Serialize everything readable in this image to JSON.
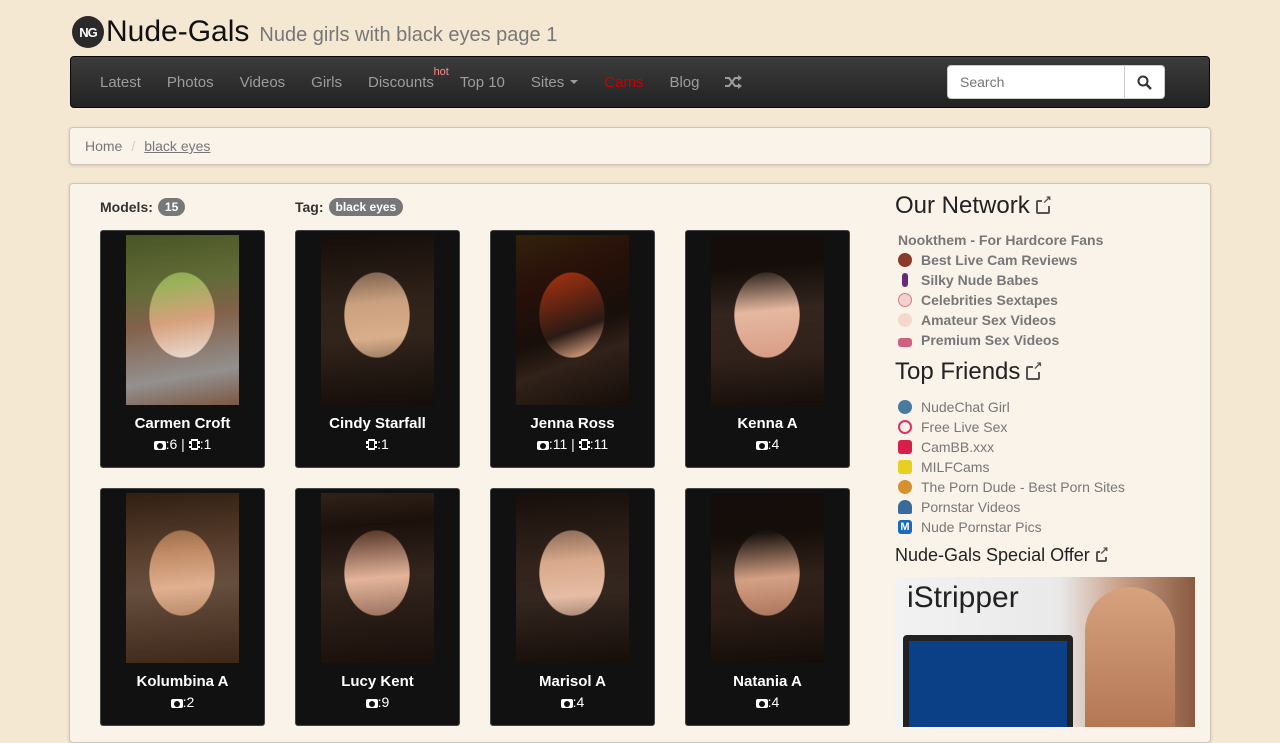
{
  "header": {
    "logo_text": "NG",
    "site_name": "Nude-Gals",
    "tagline": "Nude girls with black eyes page 1"
  },
  "nav": {
    "items": [
      {
        "label": "Latest"
      },
      {
        "label": "Photos"
      },
      {
        "label": "Videos"
      },
      {
        "label": "Girls"
      },
      {
        "label": "Discounts",
        "badge": "hot"
      },
      {
        "label": "Top 10"
      },
      {
        "label": "Sites"
      },
      {
        "label": "Cams"
      },
      {
        "label": "Blog"
      }
    ],
    "search_placeholder": "Search"
  },
  "breadcrumb": {
    "home": "Home",
    "current": "black eyes"
  },
  "main": {
    "models_label": "Models:",
    "models_count": "15",
    "tag_label": "Tag:",
    "tag_value": "black eyes",
    "cards": [
      {
        "name": "Carmen Croft",
        "photos": ":6",
        "sep": "|",
        "videos": ":1"
      },
      {
        "name": "Cindy Starfall",
        "videos": ":1"
      },
      {
        "name": "Jenna Ross",
        "photos": ":11",
        "sep": "|",
        "videos": ":11"
      },
      {
        "name": "Kenna A",
        "photos": ":4"
      },
      {
        "name": "Kolumbina A",
        "photos": ":2"
      },
      {
        "name": "Lucy Kent",
        "photos": ":9"
      },
      {
        "name": "Marisol A",
        "photos": ":4"
      },
      {
        "name": "Natania A",
        "photos": ":4"
      }
    ]
  },
  "sidebar": {
    "network_title": "Our Network",
    "network_links": [
      {
        "label": "Nookthem - For Hardcore Fans"
      },
      {
        "label": "Best Live Cam Reviews",
        "icon_color": "#8a3a2a"
      },
      {
        "label": "Silky Nude Babes",
        "icon_color": "#6a2a7a"
      },
      {
        "label": "Celebrities Sextapes",
        "icon_color": "#e2a0a0"
      },
      {
        "label": "Amateur Sex Videos",
        "icon_color": "#e8b0a0"
      },
      {
        "label": "Premium Sex Videos",
        "icon_color": "#d06080"
      }
    ],
    "friends_title": "Top Friends",
    "friends_links": [
      {
        "label": "NudeChat Girl",
        "icon_color": "#4a7aa0"
      },
      {
        "label": "Free Live Sex",
        "icon_color": "#e0306a"
      },
      {
        "label": "CamBB.xxx",
        "icon_color": "#d81e4a"
      },
      {
        "label": "MILFCams",
        "icon_color": "#e8d020"
      },
      {
        "label": "The Porn Dude - Best Porn Sites",
        "icon_color": "#d89030"
      },
      {
        "label": "Pornstar Videos",
        "icon_color": "#3a6a9a"
      },
      {
        "label": "Nude Pornstar Pics",
        "icon_color": "#1a6ac0"
      }
    ],
    "offer_title": "Nude-Gals Special Offer",
    "banner_title": "iStripper"
  }
}
